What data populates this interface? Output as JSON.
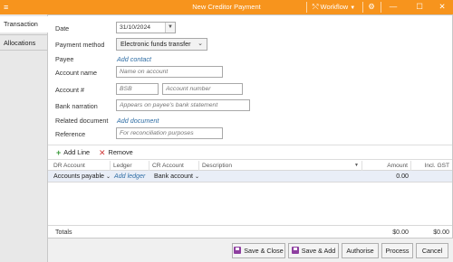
{
  "window": {
    "title": "New Creditor Payment",
    "menu_icon": "≡",
    "workflow_label": "Workflow",
    "workflow_icon": "workflow-icon",
    "controls": [
      "⚙",
      "—",
      "☐",
      "✕"
    ]
  },
  "tabs": [
    {
      "label": "Transaction",
      "active": true
    },
    {
      "label": "Allocations",
      "active": false
    }
  ],
  "form": {
    "date_label": "Date",
    "date_value": "31/10/2024",
    "payment_method_label": "Payment method",
    "payment_method_value": "Electronic funds transfer",
    "payee_label": "Payee",
    "payee_link": "Add contact",
    "account_name_label": "Account name",
    "account_name_placeholder": "Name on account",
    "account_num_label": "Account #",
    "bsb_placeholder": "BSB",
    "account_number_placeholder": "Account number",
    "bank_narration_label": "Bank narration",
    "bank_narration_placeholder": "Appears on payee's bank statement",
    "related_document_label": "Related document",
    "related_document_link": "Add document",
    "reference_label": "Reference",
    "reference_placeholder": "For reconciliation purposes"
  },
  "grid_toolbar": {
    "add_line": "Add Line",
    "remove": "Remove"
  },
  "grid": {
    "columns": [
      "DR Account",
      "Ledger",
      "CR Account",
      "Description",
      "Amount",
      "Incl. GST"
    ],
    "rows": [
      {
        "dr_account": "Accounts payable",
        "ledger": "Add ledger",
        "cr_account": "Bank account",
        "description": "",
        "amount": "0.00",
        "incl_gst": ""
      }
    ],
    "totals_label": "Totals",
    "totals_amount": "$0.00",
    "totals_gst": "$0.00"
  },
  "buttons": {
    "save_close": "Save & Close",
    "save_add": "Save & Add",
    "authorise": "Authorise",
    "process": "Process",
    "cancel": "Cancel"
  },
  "colors": {
    "titlebar": "#f7941d",
    "link": "#2e6da4",
    "selected_row": "#e9eef7"
  }
}
